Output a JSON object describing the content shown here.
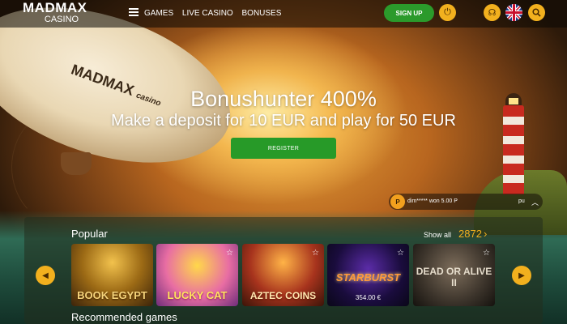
{
  "header": {
    "logo_main": "MADMAX",
    "logo_sub": "CASINO",
    "nav": [
      "GAMES",
      "LIVE CASINO",
      "BONUSES"
    ],
    "signup_label": "SIGN UP",
    "icons": {
      "power": "power-icon",
      "support": "headset-icon",
      "language": "uk-flag-icon",
      "search": "search-icon"
    }
  },
  "hero": {
    "blimp_text": "MADMAX",
    "blimp_casino": "casino",
    "title": "Bonushunter 400%",
    "subtitle": "Make a deposit for 10 EUR and play for 50 EUR",
    "register_label": "REGISTER"
  },
  "ticker": {
    "avatar_letter": "P",
    "text": "dim***** won 5.00 P",
    "suffix": "pu"
  },
  "popular": {
    "title": "Popular",
    "show_all_label": "Show all",
    "count": "2872",
    "games": [
      {
        "title": "BOOK EGYPT",
        "price": ""
      },
      {
        "title": "LUCKY CAT",
        "price": ""
      },
      {
        "title": "AZTEC COINS",
        "price": ""
      },
      {
        "title": "STARBURST",
        "price": "354.00 €"
      },
      {
        "title": "DEAD OR ALIVE II",
        "price": ""
      }
    ]
  },
  "recommended": {
    "title": "Recommended games"
  },
  "colors": {
    "accent": "#f2b01e",
    "green_button": "#279a28"
  }
}
